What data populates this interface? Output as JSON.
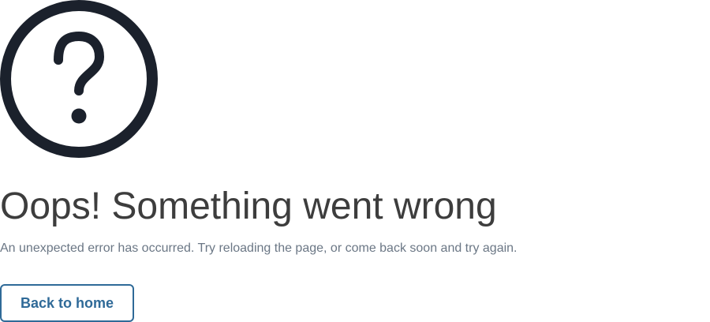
{
  "error": {
    "icon": "question-mark-circle-icon",
    "title": "Oops! Something went wrong",
    "message": "An unexpected error has occurred. Try reloading the page, or come back soon and try again.",
    "action_label": "Back to home"
  },
  "colors": {
    "icon": "#1b212c",
    "title": "#3d3d3d",
    "message": "#6b7785",
    "accent": "#2f6a98",
    "background": "#ffffff"
  }
}
